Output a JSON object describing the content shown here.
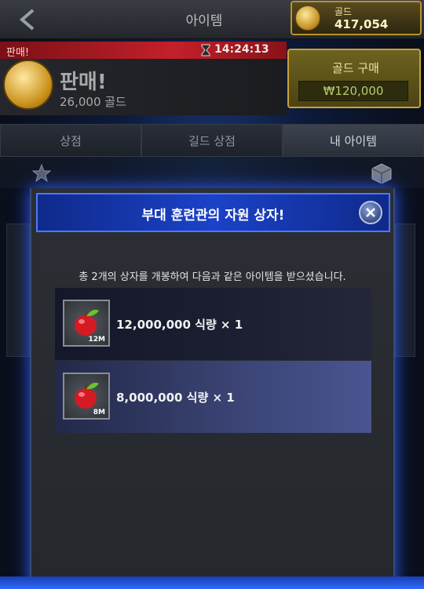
{
  "header": {
    "title": "아이템",
    "gold_label": "골드",
    "gold_value": "417,054"
  },
  "sale": {
    "strip_label": "판매!",
    "timer": "14:24:13",
    "title": "판매!",
    "subtitle": "26,000 골드",
    "buy_label": "골드 구매",
    "buy_price": "₩120,000"
  },
  "tabs": [
    {
      "label": "상점"
    },
    {
      "label": "길드 상점"
    },
    {
      "label": "내 아이템"
    }
  ],
  "modal": {
    "title": "부대 훈련관의 자원 상자!",
    "description": "총 2개의 상자를 개봉하여 다음과 같은 아이템을 받으셨습니다.",
    "items": [
      {
        "badge": "12M",
        "text": "12,000,000 식량 × 1",
        "icon": "apple-icon"
      },
      {
        "badge": "8M",
        "text": "8,000,000 식량 × 1",
        "icon": "apple-icon"
      }
    ]
  }
}
